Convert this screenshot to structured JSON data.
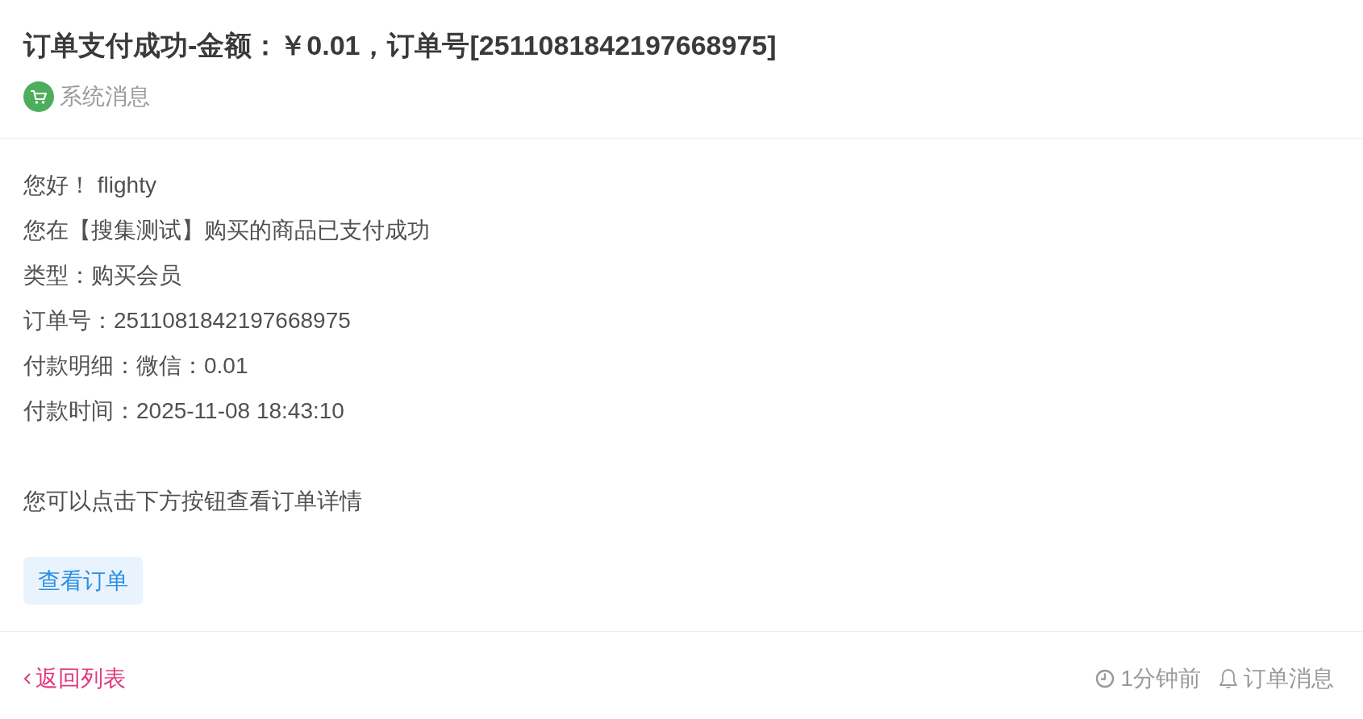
{
  "message": {
    "title": "订单支付成功-金额：￥0.01，订单号[2511081842197668975]",
    "source": {
      "label": "系统消息"
    }
  },
  "body": {
    "lines": [
      "您好！ flighty",
      "您在【搜集测试】购买的商品已支付成功",
      "类型：购买会员",
      "订单号：2511081842197668975",
      "付款明细：微信：0.01",
      "付款时间：2025-11-08 18:43:10"
    ],
    "note": "您可以点击下方按钮查看订单详情",
    "action": {
      "label": "查看订单"
    }
  },
  "footer": {
    "back_link": {
      "label": "返回列表"
    },
    "time": "1分钟前",
    "category": "订单消息"
  }
}
